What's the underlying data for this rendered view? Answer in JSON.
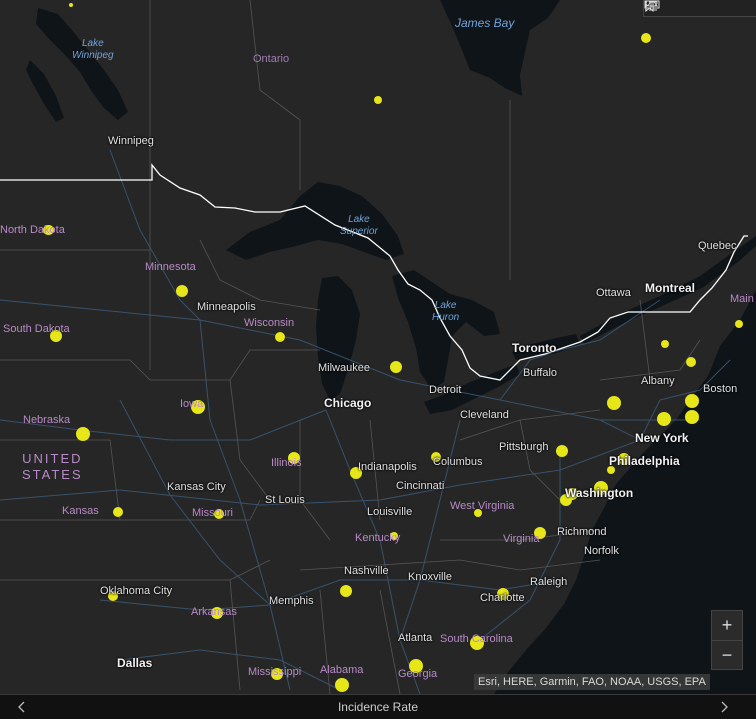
{
  "basemap": {
    "water": [
      {
        "id": "lake-winnipeg",
        "name": "Lake\nWinnipeg"
      },
      {
        "id": "james-bay",
        "name": "James Bay"
      },
      {
        "id": "lake-superior",
        "name": "Lake\nSuperior"
      },
      {
        "id": "lake-huron",
        "name": "Lake\nHuron"
      }
    ],
    "regions": [
      {
        "id": "ontario",
        "name": "Ontario"
      }
    ],
    "country": "UNITED\nSTATES",
    "states": [
      {
        "id": "north-dakota",
        "name": "North Dakota"
      },
      {
        "id": "minnesota",
        "name": "Minnesota"
      },
      {
        "id": "south-dakota",
        "name": "South Dakota"
      },
      {
        "id": "wisconsin",
        "name": "Wisconsin"
      },
      {
        "id": "nebraska",
        "name": "Nebraska"
      },
      {
        "id": "iowa",
        "name": "Iowa"
      },
      {
        "id": "illinois",
        "name": "Illinois"
      },
      {
        "id": "kansas",
        "name": "Kansas"
      },
      {
        "id": "missouri",
        "name": "Missouri"
      },
      {
        "id": "kentucky",
        "name": "Kentucky"
      },
      {
        "id": "west-virginia",
        "name": "West Virginia"
      },
      {
        "id": "virginia",
        "name": "Virginia"
      },
      {
        "id": "arkansas",
        "name": "Arkansas"
      },
      {
        "id": "south-carolina",
        "name": "South Carolina"
      },
      {
        "id": "mississippi",
        "name": "Mississippi"
      },
      {
        "id": "alabama",
        "name": "Alabama"
      },
      {
        "id": "georgia",
        "name": "Georgia"
      },
      {
        "id": "maine",
        "name": "Main"
      }
    ],
    "cities": [
      {
        "id": "winnipeg",
        "name": "Winnipeg"
      },
      {
        "id": "minneapolis",
        "name": "Minneapolis"
      },
      {
        "id": "milwaukee",
        "name": "Milwaukee"
      },
      {
        "id": "chicago",
        "name": "Chicago",
        "major": true
      },
      {
        "id": "detroit",
        "name": "Detroit"
      },
      {
        "id": "toronto",
        "name": "Toronto"
      },
      {
        "id": "buffalo",
        "name": "Buffalo"
      },
      {
        "id": "cleveland",
        "name": "Cleveland"
      },
      {
        "id": "ottawa",
        "name": "Ottawa"
      },
      {
        "id": "montreal",
        "name": "Montreal",
        "major": true
      },
      {
        "id": "quebec",
        "name": "Quebec"
      },
      {
        "id": "albany",
        "name": "Albany"
      },
      {
        "id": "boston",
        "name": "Boston"
      },
      {
        "id": "new-york",
        "name": "New York",
        "major": true
      },
      {
        "id": "philadelphia",
        "name": "Philadelphia",
        "major": true
      },
      {
        "id": "pittsburgh",
        "name": "Pittsburgh"
      },
      {
        "id": "columbus",
        "name": "Columbus"
      },
      {
        "id": "indianapolis",
        "name": "Indianapolis"
      },
      {
        "id": "cincinnati",
        "name": "Cincinnati"
      },
      {
        "id": "washington",
        "name": "Washington",
        "major": true
      },
      {
        "id": "richmond",
        "name": "Richmond"
      },
      {
        "id": "norfolk",
        "name": "Norfolk"
      },
      {
        "id": "kansas-city",
        "name": "Kansas City"
      },
      {
        "id": "st-louis",
        "name": "St Louis"
      },
      {
        "id": "louisville",
        "name": "Louisville"
      },
      {
        "id": "nashville",
        "name": "Nashville"
      },
      {
        "id": "knoxville",
        "name": "Knoxville"
      },
      {
        "id": "raleigh",
        "name": "Raleigh"
      },
      {
        "id": "charlotte",
        "name": "Charlotte"
      },
      {
        "id": "oklahoma-city",
        "name": "Oklahoma City"
      },
      {
        "id": "memphis",
        "name": "Memphis"
      },
      {
        "id": "atlanta",
        "name": "Atlanta"
      },
      {
        "id": "dallas",
        "name": "Dallas",
        "major": true
      }
    ]
  },
  "layer": {
    "title": "Incidence Rate",
    "point_color": "#e6e619",
    "point_count": 41
  },
  "toolbar": {
    "icons": [
      "bookmark-icon",
      "legend-list-icon",
      "layer-toggle-icon"
    ]
  },
  "zoom": {
    "in_label": "+",
    "out_label": "−"
  },
  "attribution": "Esri, HERE, Garmin, FAO, NOAA, USGS, EPA",
  "footer": {
    "prev_icon": "chevron-left-icon",
    "next_icon": "chevron-right-icon"
  },
  "colors": {
    "land": "#262626",
    "water": "#0f1419",
    "border": "#ffffff",
    "roads": "#3a5a78",
    "accent": "#e6e619"
  }
}
